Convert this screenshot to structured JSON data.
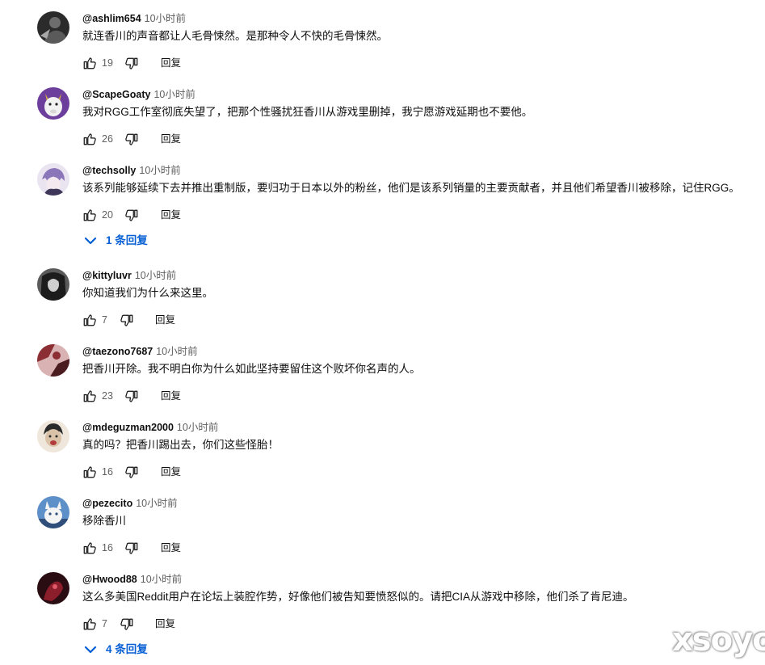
{
  "comments": [
    {
      "author": "@ashlim654",
      "time": "10小时前",
      "text": "就连香川的声音都让人毛骨悚然。是那种令人不快的毛骨悚然。",
      "likes": "19",
      "reply_label": "回复",
      "avatar_icon": "avatar-dark-figure",
      "avatar_colors": [
        "#2b2b2b",
        "#6d6d6d",
        "#a7a7a7"
      ]
    },
    {
      "author": "@ScapeGoaty",
      "time": "10小时前",
      "text": "我对RGG工作室彻底失望了，把那个性骚扰狂香川从游戏里删掉，我宁愿游戏延期也不要他。",
      "likes": "26",
      "reply_label": "回复",
      "avatar_icon": "avatar-white-goat",
      "avatar_colors": [
        "#6d3f9c",
        "#f2f2f2",
        "#c9a24a"
      ]
    },
    {
      "author": "@techsolly",
      "time": "10小时前",
      "text": "该系列能够延续下去并推出重制版，要归功于日本以外的粉丝，他们是该系列销量的主要贡献者，并且他们希望香川被移除，记住RGG。",
      "likes": "20",
      "reply_label": "回复",
      "replies_label": "1 条回复",
      "avatar_icon": "avatar-anime-character",
      "avatar_colors": [
        "#e9e4f0",
        "#8a76b8",
        "#3d3658"
      ]
    },
    {
      "author": "@kittyluvr",
      "time": "10小时前",
      "text": "你知道我们为什么来这里。",
      "likes": "7",
      "reply_label": "回复",
      "avatar_icon": "avatar-dark-hair-portrait",
      "avatar_colors": [
        "#1c1c1c",
        "#cfcfcf",
        "#5a5a5a"
      ]
    },
    {
      "author": "@taezono7687",
      "time": "10小时前",
      "text": "把香川开除。我不明白你为什么如此坚持要留住这个败坏你名声的人。",
      "likes": "23",
      "reply_label": "回复",
      "avatar_icon": "avatar-red-art",
      "avatar_colors": [
        "#8c2f35",
        "#d9b3b3",
        "#4a1c20"
      ]
    },
    {
      "author": "@mdeguzman2000",
      "time": "10小时前",
      "text": "真的吗？把香川踢出去，你们这些怪胎！",
      "likes": "16",
      "reply_label": "回复",
      "avatar_icon": "avatar-person-photo",
      "avatar_colors": [
        "#d9c2a7",
        "#2a2a2a",
        "#b33a3a"
      ]
    },
    {
      "author": "@pezecito",
      "time": "10小时前",
      "text": "移除香川",
      "likes": "16",
      "reply_label": "回复",
      "avatar_icon": "avatar-white-creature",
      "avatar_colors": [
        "#5d8fc8",
        "#f4f4f4",
        "#2f4f7a"
      ]
    },
    {
      "author": "@Hwood88",
      "time": "10小时前",
      "text": "这么多美国Reddit用户在论坛上装腔作势，好像他们被告知要愤怒似的。请把CIA从游戏中移除，他们杀了肯尼迪。",
      "likes": "7",
      "reply_label": "回复",
      "replies_label": "4 条回复",
      "avatar_icon": "avatar-dark-red-art",
      "avatar_colors": [
        "#2a0d12",
        "#8c1d2a",
        "#e05a6a"
      ]
    }
  ],
  "icons": {
    "like": "thumbs-up-icon",
    "dislike": "thumbs-down-icon",
    "expand": "chevron-down-icon"
  },
  "colors": {
    "author": "#0f0f0f",
    "meta": "#606060",
    "link": "#065fd4"
  },
  "watermark": "xsoyo"
}
